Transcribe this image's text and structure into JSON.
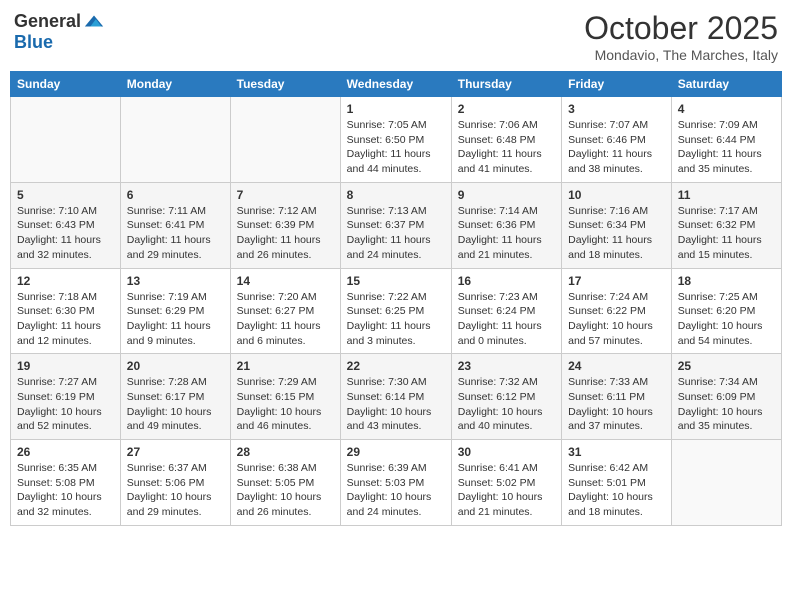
{
  "header": {
    "logo_general": "General",
    "logo_blue": "Blue",
    "month_title": "October 2025",
    "location": "Mondavio, The Marches, Italy"
  },
  "days_of_week": [
    "Sunday",
    "Monday",
    "Tuesday",
    "Wednesday",
    "Thursday",
    "Friday",
    "Saturday"
  ],
  "weeks": [
    [
      {
        "day": "",
        "info": ""
      },
      {
        "day": "",
        "info": ""
      },
      {
        "day": "",
        "info": ""
      },
      {
        "day": "1",
        "info": "Sunrise: 7:05 AM\nSunset: 6:50 PM\nDaylight: 11 hours and 44 minutes."
      },
      {
        "day": "2",
        "info": "Sunrise: 7:06 AM\nSunset: 6:48 PM\nDaylight: 11 hours and 41 minutes."
      },
      {
        "day": "3",
        "info": "Sunrise: 7:07 AM\nSunset: 6:46 PM\nDaylight: 11 hours and 38 minutes."
      },
      {
        "day": "4",
        "info": "Sunrise: 7:09 AM\nSunset: 6:44 PM\nDaylight: 11 hours and 35 minutes."
      }
    ],
    [
      {
        "day": "5",
        "info": "Sunrise: 7:10 AM\nSunset: 6:43 PM\nDaylight: 11 hours and 32 minutes."
      },
      {
        "day": "6",
        "info": "Sunrise: 7:11 AM\nSunset: 6:41 PM\nDaylight: 11 hours and 29 minutes."
      },
      {
        "day": "7",
        "info": "Sunrise: 7:12 AM\nSunset: 6:39 PM\nDaylight: 11 hours and 26 minutes."
      },
      {
        "day": "8",
        "info": "Sunrise: 7:13 AM\nSunset: 6:37 PM\nDaylight: 11 hours and 24 minutes."
      },
      {
        "day": "9",
        "info": "Sunrise: 7:14 AM\nSunset: 6:36 PM\nDaylight: 11 hours and 21 minutes."
      },
      {
        "day": "10",
        "info": "Sunrise: 7:16 AM\nSunset: 6:34 PM\nDaylight: 11 hours and 18 minutes."
      },
      {
        "day": "11",
        "info": "Sunrise: 7:17 AM\nSunset: 6:32 PM\nDaylight: 11 hours and 15 minutes."
      }
    ],
    [
      {
        "day": "12",
        "info": "Sunrise: 7:18 AM\nSunset: 6:30 PM\nDaylight: 11 hours and 12 minutes."
      },
      {
        "day": "13",
        "info": "Sunrise: 7:19 AM\nSunset: 6:29 PM\nDaylight: 11 hours and 9 minutes."
      },
      {
        "day": "14",
        "info": "Sunrise: 7:20 AM\nSunset: 6:27 PM\nDaylight: 11 hours and 6 minutes."
      },
      {
        "day": "15",
        "info": "Sunrise: 7:22 AM\nSunset: 6:25 PM\nDaylight: 11 hours and 3 minutes."
      },
      {
        "day": "16",
        "info": "Sunrise: 7:23 AM\nSunset: 6:24 PM\nDaylight: 11 hours and 0 minutes."
      },
      {
        "day": "17",
        "info": "Sunrise: 7:24 AM\nSunset: 6:22 PM\nDaylight: 10 hours and 57 minutes."
      },
      {
        "day": "18",
        "info": "Sunrise: 7:25 AM\nSunset: 6:20 PM\nDaylight: 10 hours and 54 minutes."
      }
    ],
    [
      {
        "day": "19",
        "info": "Sunrise: 7:27 AM\nSunset: 6:19 PM\nDaylight: 10 hours and 52 minutes."
      },
      {
        "day": "20",
        "info": "Sunrise: 7:28 AM\nSunset: 6:17 PM\nDaylight: 10 hours and 49 minutes."
      },
      {
        "day": "21",
        "info": "Sunrise: 7:29 AM\nSunset: 6:15 PM\nDaylight: 10 hours and 46 minutes."
      },
      {
        "day": "22",
        "info": "Sunrise: 7:30 AM\nSunset: 6:14 PM\nDaylight: 10 hours and 43 minutes."
      },
      {
        "day": "23",
        "info": "Sunrise: 7:32 AM\nSunset: 6:12 PM\nDaylight: 10 hours and 40 minutes."
      },
      {
        "day": "24",
        "info": "Sunrise: 7:33 AM\nSunset: 6:11 PM\nDaylight: 10 hours and 37 minutes."
      },
      {
        "day": "25",
        "info": "Sunrise: 7:34 AM\nSunset: 6:09 PM\nDaylight: 10 hours and 35 minutes."
      }
    ],
    [
      {
        "day": "26",
        "info": "Sunrise: 6:35 AM\nSunset: 5:08 PM\nDaylight: 10 hours and 32 minutes."
      },
      {
        "day": "27",
        "info": "Sunrise: 6:37 AM\nSunset: 5:06 PM\nDaylight: 10 hours and 29 minutes."
      },
      {
        "day": "28",
        "info": "Sunrise: 6:38 AM\nSunset: 5:05 PM\nDaylight: 10 hours and 26 minutes."
      },
      {
        "day": "29",
        "info": "Sunrise: 6:39 AM\nSunset: 5:03 PM\nDaylight: 10 hours and 24 minutes."
      },
      {
        "day": "30",
        "info": "Sunrise: 6:41 AM\nSunset: 5:02 PM\nDaylight: 10 hours and 21 minutes."
      },
      {
        "day": "31",
        "info": "Sunrise: 6:42 AM\nSunset: 5:01 PM\nDaylight: 10 hours and 18 minutes."
      },
      {
        "day": "",
        "info": ""
      }
    ]
  ]
}
